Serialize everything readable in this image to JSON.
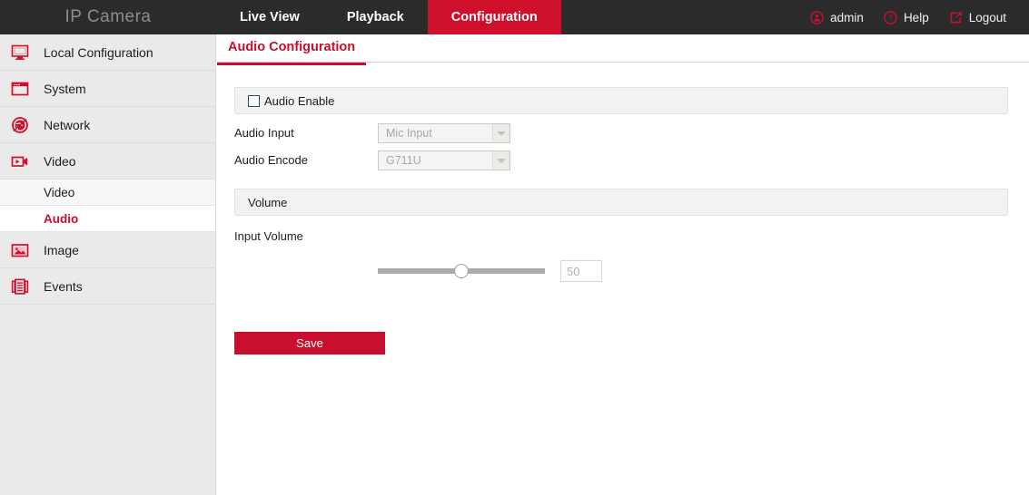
{
  "header": {
    "brand": "IP Camera",
    "tabs": [
      {
        "label": "Live View",
        "active": false
      },
      {
        "label": "Playback",
        "active": false
      },
      {
        "label": "Configuration",
        "active": true
      }
    ],
    "user_label": "admin",
    "help_label": "Help",
    "logout_label": "Logout",
    "bg_color": "#2b2b2b",
    "accent_color": "#cf102d"
  },
  "sidebar": {
    "items": [
      {
        "label": "Local Configuration",
        "icon": "monitor-icon"
      },
      {
        "label": "System",
        "icon": "window-icon"
      },
      {
        "label": "Network",
        "icon": "globe-icon"
      },
      {
        "label": "Video",
        "icon": "video-camera-icon"
      }
    ],
    "video_subitems": [
      {
        "label": "Video",
        "active": false
      },
      {
        "label": "Audio",
        "active": true
      }
    ],
    "items_after": [
      {
        "label": "Image",
        "icon": "picture-icon"
      },
      {
        "label": "Events",
        "icon": "events-icon"
      }
    ]
  },
  "content": {
    "tab_label": "Audio Configuration",
    "audio_enable": {
      "label": "Audio Enable",
      "checked": false
    },
    "audio_input": {
      "label": "Audio Input",
      "value": "Mic Input",
      "disabled": true
    },
    "audio_encode": {
      "label": "Audio Encode",
      "value": "G711U",
      "disabled": true
    },
    "volume_section_label": "Volume",
    "input_volume": {
      "label": "Input Volume",
      "value": "50",
      "slider_percent": 50,
      "min": 0,
      "max": 100
    },
    "save_label": "Save"
  }
}
